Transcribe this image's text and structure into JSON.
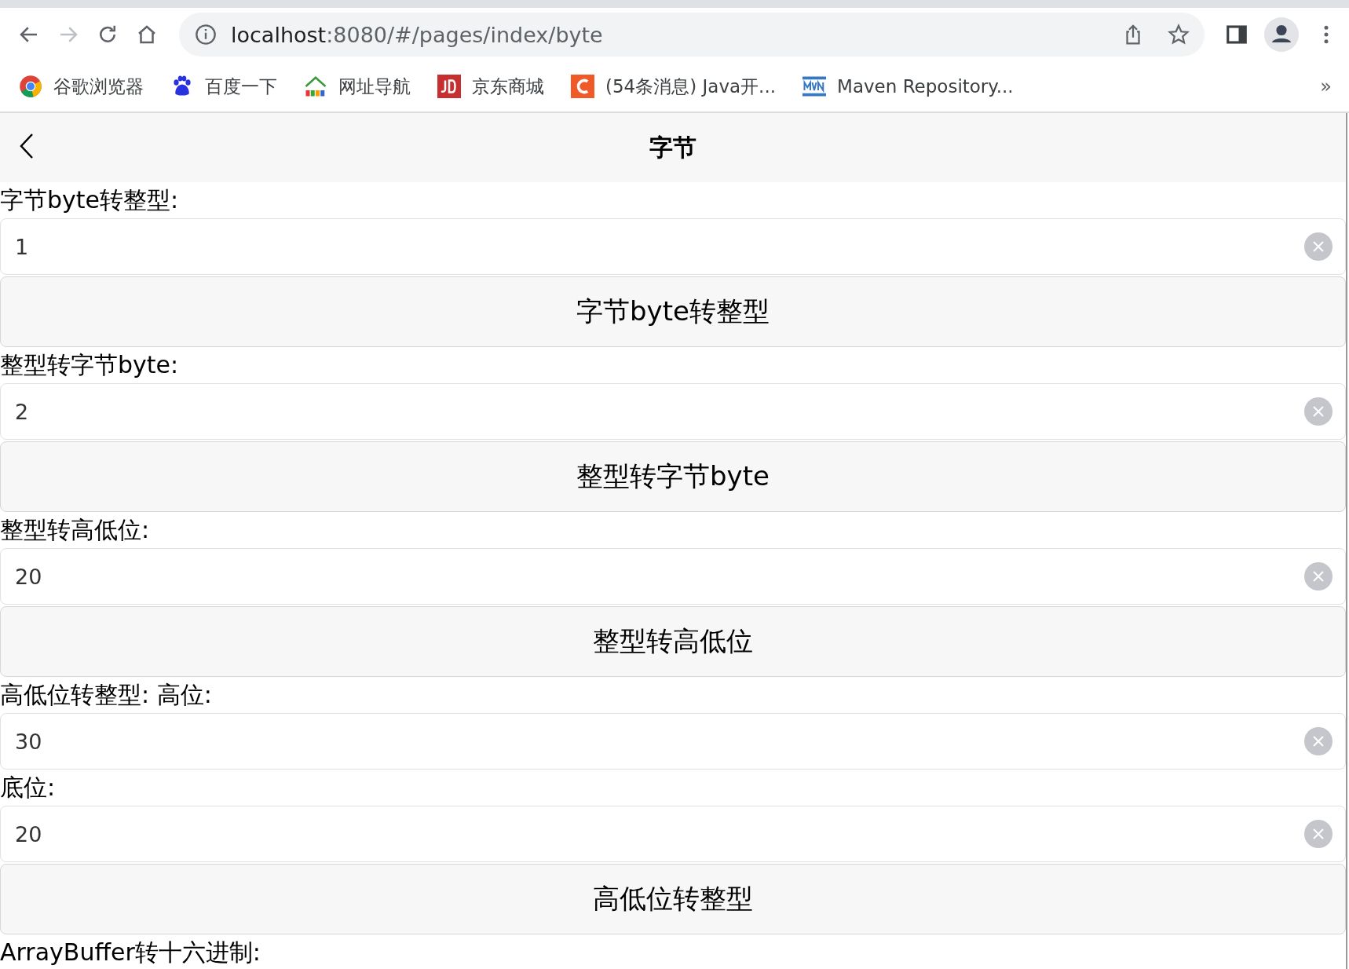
{
  "browser": {
    "url_host": "localhost",
    "url_rest": ":8080/#/pages/index/byte",
    "bookmarks": [
      {
        "label": "谷歌浏览器",
        "kind": "chrome"
      },
      {
        "label": "百度一下",
        "kind": "paw"
      },
      {
        "label": "网址导航",
        "kind": "house"
      },
      {
        "label": "京东商城",
        "kind": "jd"
      },
      {
        "label": "(54条消息) Java开...",
        "kind": "c"
      },
      {
        "label": "Maven Repository...",
        "kind": "mvn"
      }
    ],
    "more": "»"
  },
  "nav": {
    "title": "字节"
  },
  "form": [
    {
      "kind": "label",
      "text": "字节byte转整型:"
    },
    {
      "kind": "input",
      "value": "1"
    },
    {
      "kind": "button",
      "text": "字节byte转整型"
    },
    {
      "kind": "label",
      "text": "整型转字节byte:"
    },
    {
      "kind": "input",
      "value": "2"
    },
    {
      "kind": "button",
      "text": "整型转字节byte"
    },
    {
      "kind": "label",
      "text": "整型转高低位:"
    },
    {
      "kind": "input",
      "value": "20"
    },
    {
      "kind": "button",
      "text": "整型转高低位"
    },
    {
      "kind": "label",
      "text": "高低位转整型: 高位:"
    },
    {
      "kind": "input",
      "value": "30"
    },
    {
      "kind": "label",
      "text": "底位:"
    },
    {
      "kind": "input",
      "value": "20"
    },
    {
      "kind": "button",
      "text": "高低位转整型"
    },
    {
      "kind": "label",
      "text": "ArrayBuffer转十六进制:"
    }
  ]
}
